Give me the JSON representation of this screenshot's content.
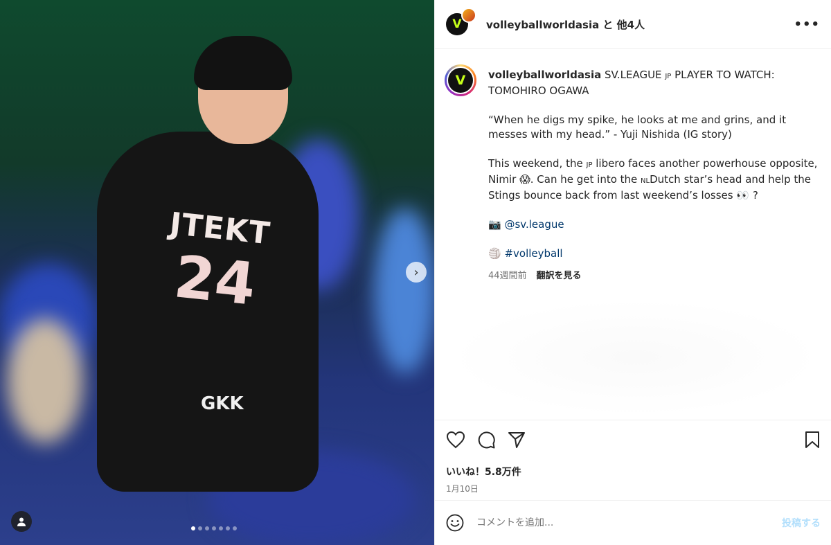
{
  "header": {
    "user": "volleyballworldasia と 他4人",
    "more_label": "•••"
  },
  "media": {
    "jersey_text": "JTEKT",
    "jersey_number": "24",
    "shorts_text": "GKK",
    "carousel_next": "›",
    "dots_total": 7,
    "dots_active": 1
  },
  "caption": {
    "username": "volleyballworldasia",
    "title": "SV.LEAGUE",
    "flag_jp": "JP",
    "title_rest": "PLAYER TO WATCH: TOMOHIRO OGAWA",
    "quote": "“When he digs my spike, he looks at me and grins, and it messes with my head.” - Yuji Nishida (IG story)",
    "para2_a": "This weekend, the",
    "para2_flag": "JP",
    "para2_b": "libero faces another powerhouse opposite, Nimir",
    "para2_emoji1": "😱",
    "para2_c": ". Can he get into the",
    "para2_flag2": "NL",
    "para2_d": "Dutch star’s head and help the Stings bounce back from last weekend’s losses",
    "para2_emoji2": "👀",
    "para2_e": "?",
    "camera_emoji": "📷",
    "mention": "@sv.league",
    "ball_emoji": "🏐",
    "hashtag": "#volleyball",
    "time_ago": "44週間前",
    "translate": "翻訳を見る"
  },
  "actions": {
    "likes": "いいね！5.8万件",
    "date": "1月10日"
  },
  "comment": {
    "placeholder": "コメントを追加...",
    "post_label": "投稿する"
  },
  "colors": {
    "brand_lime": "#c6ff1a",
    "link": "#00376b",
    "post_disabled": "#b2dffc"
  }
}
